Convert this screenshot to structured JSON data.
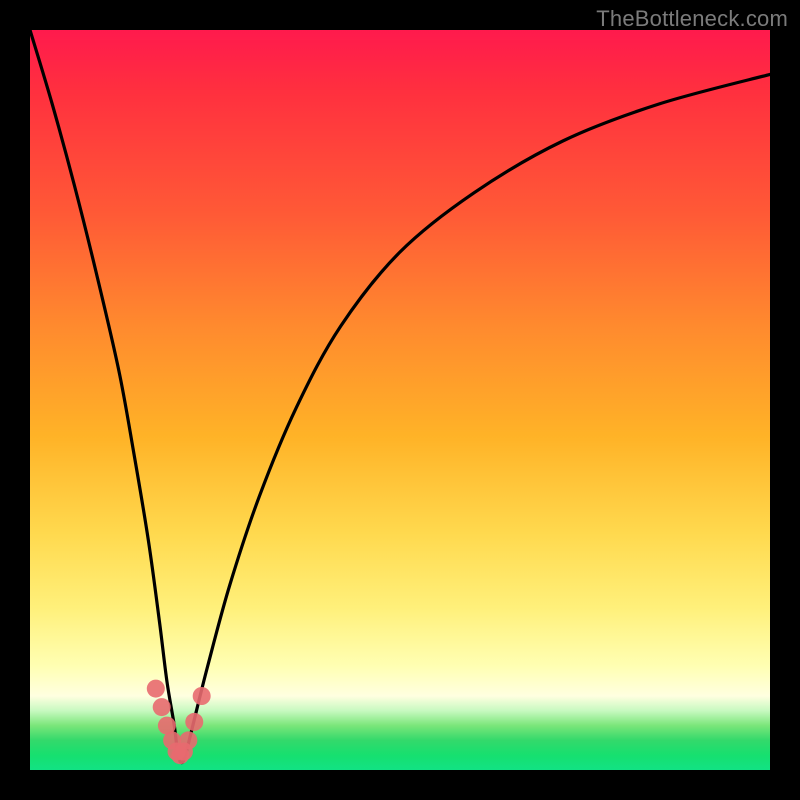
{
  "watermark": "TheBottleneck.com",
  "colors": {
    "frame": "#000000",
    "gradient_top": "#ff1a4d",
    "gradient_mid": "#ffd94e",
    "gradient_bottom": "#12e284",
    "curve": "#000000",
    "marker": "#e86a6f"
  },
  "chart_data": {
    "type": "line",
    "title": "",
    "xlabel": "",
    "ylabel": "",
    "xlim": [
      0,
      100
    ],
    "ylim": [
      0,
      100
    ],
    "series": [
      {
        "name": "bottleneck-curve",
        "x": [
          0,
          3,
          6,
          9,
          12,
          14,
          16,
          17.5,
          18.5,
          19.5,
          20,
          20.5,
          21,
          22,
          24,
          27,
          31,
          36,
          42,
          50,
          60,
          72,
          85,
          100
        ],
        "values": [
          100,
          90,
          79,
          67,
          54,
          43,
          31,
          20,
          12,
          6,
          2,
          1,
          2,
          6,
          14,
          25,
          37,
          49,
          60,
          70,
          78,
          85,
          90,
          94
        ]
      }
    ],
    "markers": {
      "name": "bottom-dots",
      "x": [
        17.0,
        17.8,
        18.5,
        19.2,
        19.8,
        20.3,
        20.8,
        21.4,
        22.2,
        23.2
      ],
      "values": [
        11.0,
        8.5,
        6.0,
        4.0,
        2.5,
        2.0,
        2.5,
        4.0,
        6.5,
        10.0
      ]
    }
  }
}
